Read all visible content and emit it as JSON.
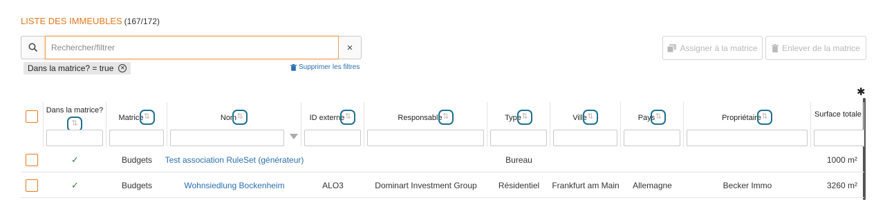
{
  "header": {
    "title": "LISTE DES IMMEUBLES",
    "count": "(167/172)"
  },
  "search": {
    "placeholder": "Rechercher/filtrer",
    "value": "",
    "clear_label": "×"
  },
  "active_filter": {
    "label": "Dans la matrice? = true"
  },
  "clear_filters_label": "Supprimer les filtres",
  "actions": {
    "assign_label": "Assigner à la matrice",
    "remove_label": "Enlever de la matrice"
  },
  "columns": [
    {
      "label": "Dans la matrice?"
    },
    {
      "label": "Matrice"
    },
    {
      "label": "Nom"
    },
    {
      "label": "ID externe"
    },
    {
      "label": "Responsable"
    },
    {
      "label": "Type"
    },
    {
      "label": "Ville"
    },
    {
      "label": "Pays"
    },
    {
      "label": "Propriétaire"
    },
    {
      "label": "Surface totale"
    }
  ],
  "rows": [
    {
      "in_matrix": "✓",
      "matrix": "Budgets",
      "name": "Test association RuleSet (générateur)",
      "external_id": "",
      "responsible": "",
      "type": "Bureau",
      "city": "",
      "country": "",
      "owner": "",
      "surface": "1000 m²"
    },
    {
      "in_matrix": "✓",
      "matrix": "Budgets",
      "name": "Wohnsiedlung Bockenheim",
      "external_id": "ALO3",
      "responsible": "Dominart Investment Group",
      "type": "Résidentiel",
      "city": "Frankfurt am Main",
      "country": "Allemagne",
      "owner": "Becker Immo",
      "surface": "3260 m²"
    }
  ],
  "colors": {
    "accent": "#e07a1f",
    "link": "#2a6fb0",
    "sort_outline": "#1e6f8c",
    "check": "#2e7d32"
  }
}
